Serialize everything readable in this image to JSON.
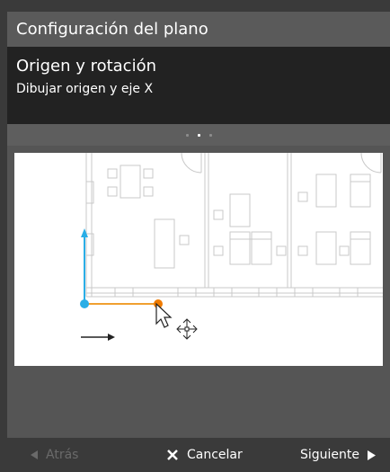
{
  "window": {
    "title": "Configuración del plano"
  },
  "step": {
    "title": "Origen y rotación",
    "subtitle": "Dibujar origen y eje X",
    "total_steps": 3,
    "current_step": 2
  },
  "footer": {
    "back_label": "Atrás",
    "cancel_label": "Cancelar",
    "next_label": "Siguiente"
  },
  "colors": {
    "y_axis": "#2aaee6",
    "x_axis": "#f0a030",
    "origin": "#2aaee6",
    "x_point": "#ef7b00"
  },
  "icons": {
    "back": "triangle-left-icon",
    "cancel": "x-icon",
    "next": "triangle-right-icon",
    "cursor": "arrow-pointer-icon",
    "move": "move-arrows-icon"
  }
}
